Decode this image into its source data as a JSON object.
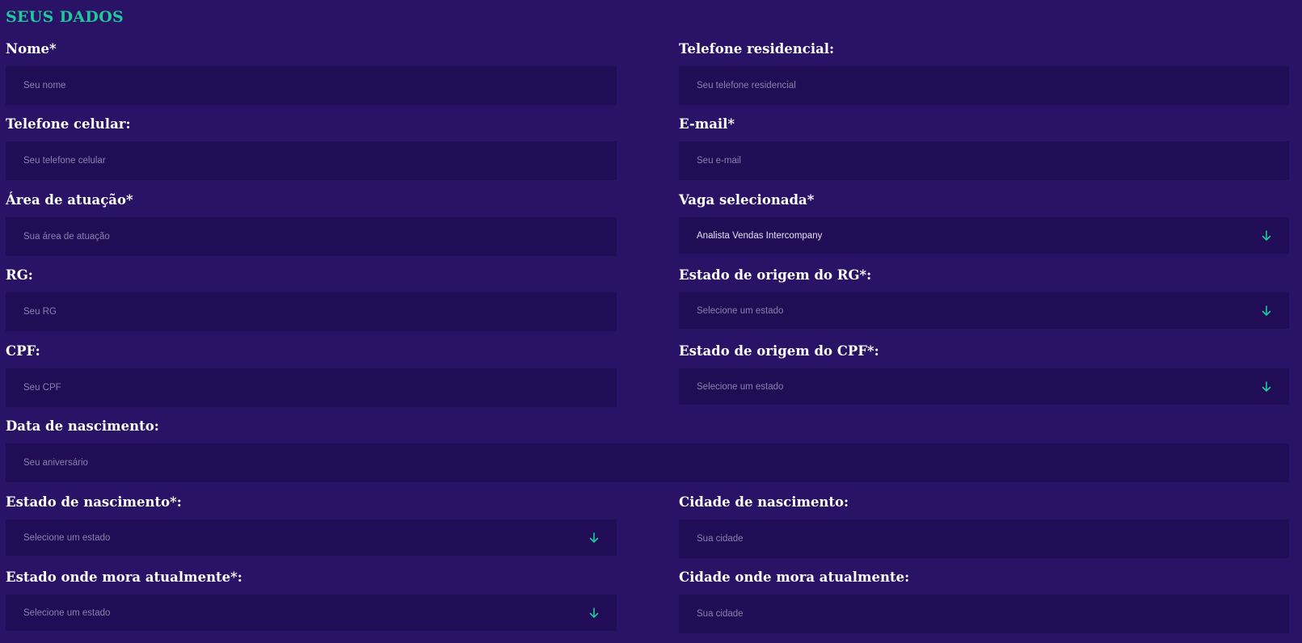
{
  "section": {
    "title": "SEUS DADOS"
  },
  "colors": {
    "background": "#2a1266",
    "field_background": "#200d55",
    "accent": "#1ec99a"
  },
  "fields": {
    "nome": {
      "label": "Nome*",
      "placeholder": "Seu nome",
      "value": ""
    },
    "telefone_residencial": {
      "label": "Telefone residencial:",
      "placeholder": "Seu telefone residencial",
      "value": ""
    },
    "telefone_celular": {
      "label": "Telefone celular:",
      "placeholder": "Seu telefone celular",
      "value": ""
    },
    "email": {
      "label": "E-mail*",
      "placeholder": "Seu e-mail",
      "value": ""
    },
    "area_atuacao": {
      "label": "Área de atuação*",
      "placeholder": "Sua área de atuação",
      "value": ""
    },
    "vaga_selecionada": {
      "label": "Vaga selecionada*",
      "selected": "Analista Vendas Intercompany",
      "icon": "arrow-down-icon"
    },
    "rg": {
      "label": "RG:",
      "placeholder": "Seu RG",
      "value": ""
    },
    "estado_origem_rg": {
      "label": "Estado de origem do RG*:",
      "selected": "Selecione um estado",
      "icon": "arrow-down-icon"
    },
    "cpf": {
      "label": "CPF:",
      "placeholder": "Seu CPF",
      "value": ""
    },
    "estado_origem_cpf": {
      "label": "Estado de origem do CPF*:",
      "selected": "Selecione um estado",
      "icon": "arrow-down-icon"
    },
    "data_nascimento": {
      "label": "Data de nascimento:",
      "placeholder": "Seu aniversário",
      "value": ""
    },
    "estado_nascimento": {
      "label": "Estado de nascimento*:",
      "selected": "Selecione um estado",
      "icon": "arrow-down-icon"
    },
    "cidade_nascimento": {
      "label": "Cidade de nascimento:",
      "placeholder": "Sua cidade",
      "value": ""
    },
    "estado_mora": {
      "label": "Estado onde mora atualmente*:",
      "selected": "Selecione um estado",
      "icon": "arrow-down-icon"
    },
    "cidade_mora": {
      "label": "Cidade onde mora atualmente:",
      "placeholder": "Sua cidade",
      "value": ""
    }
  }
}
